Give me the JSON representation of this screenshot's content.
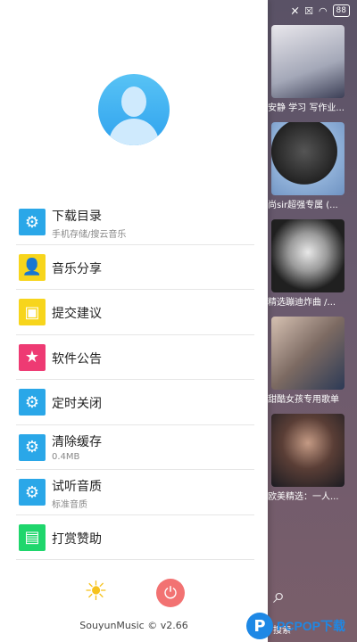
{
  "statusbar": {
    "battery": "88"
  },
  "background_playlist": [
    {
      "title": "安静 学习 写作业..."
    },
    {
      "title": "尚sir超强专属 (..."
    },
    {
      "title": "精选蹦迪炸曲 /..."
    },
    {
      "title": "甜酷女孩专用歌单"
    },
    {
      "title": "欧美精选：一人..."
    }
  ],
  "background_search": {
    "label": "搜索"
  },
  "drawer": {
    "menu": [
      {
        "label": "下载目录",
        "sub": "手机存储/搜云音乐",
        "icon": "gear-icon",
        "color": "#2aa7e8"
      },
      {
        "label": "音乐分享",
        "sub": "",
        "icon": "share-person-icon",
        "color": "#f7d51c"
      },
      {
        "label": "提交建议",
        "sub": "",
        "icon": "gift-icon",
        "color": "#f7d51c"
      },
      {
        "label": "软件公告",
        "sub": "",
        "icon": "star-icon",
        "color": "#ee3a73"
      },
      {
        "label": "定时关闭",
        "sub": "",
        "icon": "gear-icon",
        "color": "#2aa7e8"
      },
      {
        "label": "清除缓存",
        "sub": "0.4MB",
        "icon": "gear-icon",
        "color": "#2aa7e8"
      },
      {
        "label": "试听音质",
        "sub": "标准音质",
        "icon": "gear-icon",
        "color": "#2aa7e8"
      },
      {
        "label": "打赏赞助",
        "sub": "",
        "icon": "wallet-icon",
        "color": "#1fd66c"
      }
    ],
    "version": "SouyunMusic © v2.66"
  },
  "watermark": {
    "text": "PCPOP下载"
  }
}
